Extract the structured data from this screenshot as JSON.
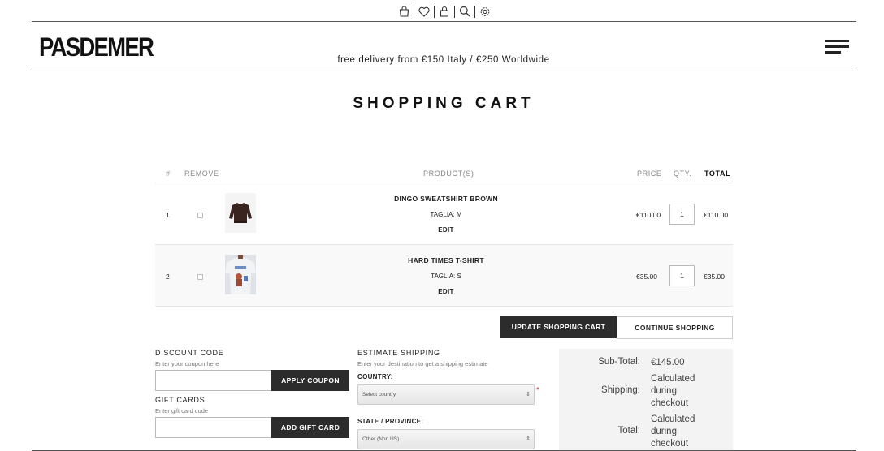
{
  "header": {
    "icons": [
      "cart-icon",
      "heart-icon",
      "lock-icon",
      "search-icon",
      "gear-icon"
    ],
    "logo": "PASDEMER",
    "promo": "free delivery from €150 Italy / €250 Worldwide"
  },
  "page_title": "SHOPPING CART",
  "cart": {
    "columns": {
      "num": "#",
      "remove": "REMOVE",
      "product": "PRODUCT(S)",
      "price": "PRICE",
      "qty": "QTY.",
      "total": "TOTAL"
    },
    "items": [
      {
        "num": "1",
        "name": "DINGO SWEATSHIRT BROWN",
        "variant": "TAGLIA: M",
        "edit": "EDIT",
        "price": "€110.00",
        "qty": "1",
        "total": "€110.00"
      },
      {
        "num": "2",
        "name": "HARD TIMES T-SHIRT",
        "variant": "TAGLIA: S",
        "edit": "EDIT",
        "price": "€35.00",
        "qty": "1",
        "total": "€35.00"
      }
    ],
    "update_button": "UPDATE SHOPPING CART",
    "continue_button": "CONTINUE SHOPPING"
  },
  "discount": {
    "title": "DISCOUNT CODE",
    "hint": "Enter your coupon here",
    "input_value": "",
    "button": "APPLY COUPON"
  },
  "gift": {
    "title": "GIFT CARDS",
    "hint": "Enter gift card code",
    "input_value": "",
    "button": "ADD GIFT CARD"
  },
  "shipping": {
    "title": "ESTIMATE SHIPPING",
    "hint": "Enter your destination to get a shipping estimate",
    "country_label": "COUNTRY:",
    "country_value": "Select country",
    "required_mark": "*",
    "state_label": "STATE / PROVINCE:",
    "state_value": "Other (Non US)"
  },
  "totals": {
    "subtotal_label": "Sub-Total:",
    "subtotal_value": "€145.00",
    "shipping_label": "Shipping:",
    "shipping_value_lines": [
      "Calculated",
      "during",
      "checkout"
    ],
    "total_label": "Total:",
    "total_value_lines": [
      "Calculated",
      "during",
      "checkout"
    ]
  }
}
